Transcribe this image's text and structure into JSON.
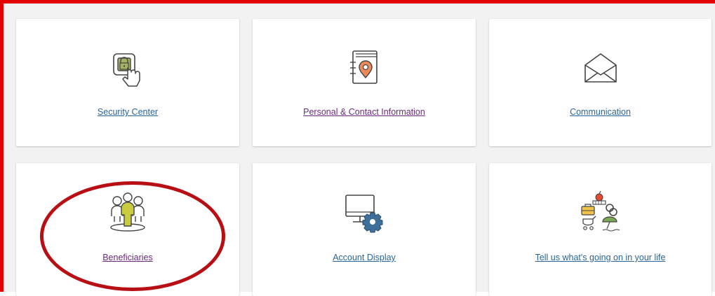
{
  "tiles": [
    {
      "label": "Security Center",
      "icon": "lock-touch-icon"
    },
    {
      "label": "Personal & Contact Information",
      "icon": "address-book-icon"
    },
    {
      "label": "Communication",
      "icon": "envelope-icon"
    },
    {
      "label": "Beneficiaries",
      "icon": "beneficiaries-people-icon"
    },
    {
      "label": "Account Display",
      "icon": "monitor-gear-icon"
    },
    {
      "label": "Tell us what's going on in your life",
      "icon": "life-events-icon"
    }
  ],
  "colors": {
    "frame_border": "#e20000",
    "highlight_ring": "#b80f14",
    "link_blue": "#2a6496",
    "link_purple": "#6b2a7a",
    "page_background": "#f2f2f2",
    "icon_green": "#a5b464",
    "icon_orange": "#ec8a5b",
    "icon_blue": "#3e6e9a"
  }
}
